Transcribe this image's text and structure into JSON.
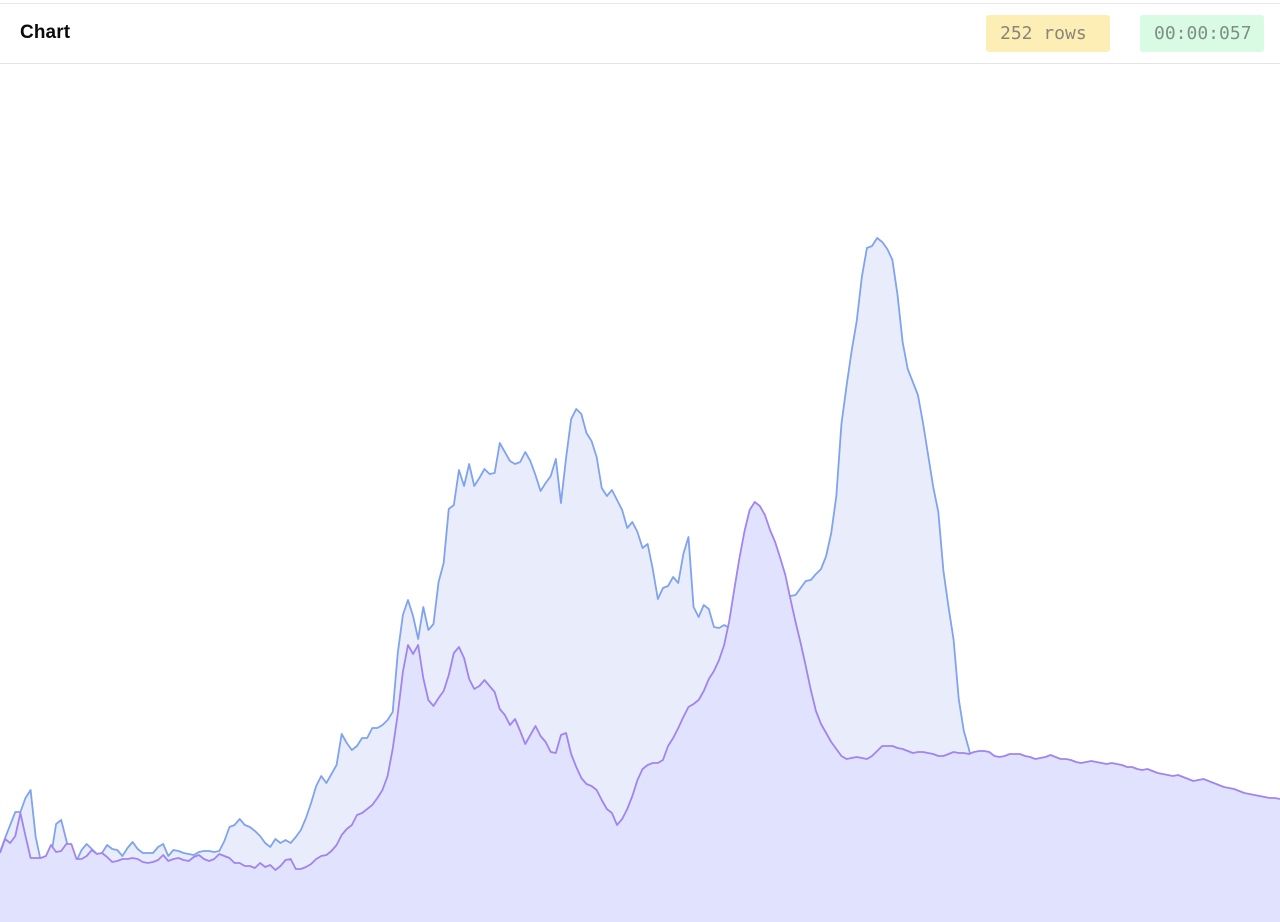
{
  "header": {
    "title": "Chart",
    "rows_badge": "252 rows",
    "time_badge": "00:00:057"
  },
  "colors": {
    "series_a_line": "#7fa3ee",
    "series_a_fill": "#e9edfb",
    "series_b_line": "#a184f0",
    "series_b_fill": "#e1e2fd",
    "rows_badge_bg": "#fdeeb6",
    "time_badge_bg": "#d9fbe3"
  },
  "chart_data": {
    "type": "area",
    "x_count": 252,
    "title": "",
    "xlabel": "",
    "ylabel": "",
    "ylim": [
      0,
      857
    ],
    "grid": false,
    "legend": "none",
    "series": [
      {
        "values": [
          70,
          84,
          97,
          110,
          110,
          124,
          132,
          85,
          61,
          66,
          66,
          98,
          102,
          82,
          61,
          61,
          72,
          78,
          73,
          68,
          69,
          77,
          73,
          72,
          66,
          74,
          80,
          73,
          69,
          69,
          69,
          75,
          78,
          66,
          72,
          71,
          69,
          68,
          67,
          70,
          71,
          71,
          70,
          71,
          81,
          95,
          97,
          103,
          97,
          95,
          91,
          86,
          79,
          75,
          83,
          79,
          82,
          79,
          85,
          92,
          104,
          119,
          136,
          146,
          139,
          148,
          157,
          188,
          179,
          172,
          176,
          184,
          184,
          194,
          194,
          197,
          202,
          210,
          269,
          307,
          322,
          306,
          283,
          315,
          292,
          298,
          340,
          359,
          413,
          417,
          452,
          436,
          458,
          436,
          444,
          453,
          448,
          449,
          479,
          470,
          461,
          458,
          460,
          470,
          461,
          447,
          431,
          439,
          446,
          463,
          419,
          464,
          503,
          513,
          508,
          489,
          481,
          465,
          434,
          426,
          432,
          422,
          412,
          394,
          400,
          390,
          374,
          378,
          353,
          323,
          334,
          336,
          345,
          339,
          368,
          385,
          315,
          305,
          317,
          313,
          295,
          294,
          297,
          294,
          299,
          291,
          281,
          283,
          290,
          293,
          289,
          299,
          300,
          312,
          318,
          326,
          327,
          334,
          341,
          342,
          348,
          353,
          366,
          389,
          426,
          498,
          536,
          571,
          601,
          645,
          674,
          676,
          684,
          680,
          673,
          662,
          627,
          580,
          553,
          540,
          527,
          499,
          467,
          435,
          410,
          351,
          315,
          282,
          223,
          191,
          173,
          150,
          132,
          119,
          101,
          94,
          86,
          80,
          76,
          72,
          68,
          69,
          68,
          64,
          67,
          63,
          58,
          65,
          62,
          63,
          61,
          61,
          67,
          76,
          83,
          92,
          88,
          80,
          78,
          80,
          75,
          76,
          70,
          69,
          69,
          72,
          74,
          70,
          66,
          68,
          65,
          68,
          73,
          72,
          72,
          69,
          75,
          79,
          81,
          77,
          82,
          88,
          93,
          88,
          83,
          87,
          92,
          89,
          85,
          86,
          88,
          90,
          84,
          79,
          84,
          89,
          85,
          82,
          77
        ]
      },
      {
        "values": [
          69,
          83,
          79,
          86,
          109,
          86,
          64,
          64,
          64,
          66,
          77,
          70,
          71,
          78,
          78,
          63,
          63,
          66,
          72,
          68,
          69,
          65,
          60,
          61,
          63,
          63,
          64,
          63,
          60,
          59,
          60,
          62,
          67,
          61,
          63,
          64,
          62,
          61,
          65,
          67,
          63,
          61,
          63,
          68,
          66,
          64,
          59,
          59,
          56,
          56,
          54,
          59,
          55,
          57,
          52,
          56,
          62,
          63,
          53,
          53,
          55,
          58,
          63,
          66,
          67,
          71,
          77,
          87,
          93,
          97,
          107,
          109,
          113,
          117,
          124,
          132,
          146,
          173,
          208,
          250,
          277,
          268,
          277,
          244,
          222,
          216,
          224,
          231,
          247,
          269,
          275,
          264,
          243,
          233,
          236,
          242,
          236,
          230,
          213,
          207,
          197,
          203,
          191,
          178,
          187,
          196,
          186,
          180,
          170,
          169,
          187,
          189,
          168,
          155,
          144,
          138,
          136,
          132,
          122,
          113,
          109,
          97,
          103,
          113,
          126,
          142,
          153,
          157,
          159,
          159,
          162,
          176,
          184,
          194,
          205,
          215,
          218,
          222,
          231,
          243,
          251,
          262,
          277,
          301,
          333,
          364,
          391,
          412,
          420,
          416,
          407,
          392,
          380,
          364,
          347,
          323,
          300,
          279,
          256,
          232,
          211,
          198,
          189,
          180,
          173,
          166,
          163,
          164,
          165,
          164,
          163,
          166,
          171,
          176,
          176,
          176,
          174,
          173,
          171,
          169,
          170,
          170,
          169,
          168,
          166,
          166,
          168,
          170,
          169,
          169,
          168,
          170,
          171,
          171,
          170,
          166,
          165,
          166,
          168,
          168,
          168,
          166,
          165,
          163,
          164,
          165,
          167,
          165,
          163,
          163,
          162,
          160,
          159,
          160,
          161,
          160,
          159,
          158,
          159,
          158,
          157,
          155,
          155,
          153,
          152,
          153,
          151,
          149,
          148,
          147,
          146,
          147,
          145,
          143,
          141,
          142,
          143,
          141,
          139,
          137,
          135,
          134,
          133,
          131,
          129,
          128,
          127,
          126,
          125,
          124,
          124,
          123
        ]
      }
    ]
  }
}
